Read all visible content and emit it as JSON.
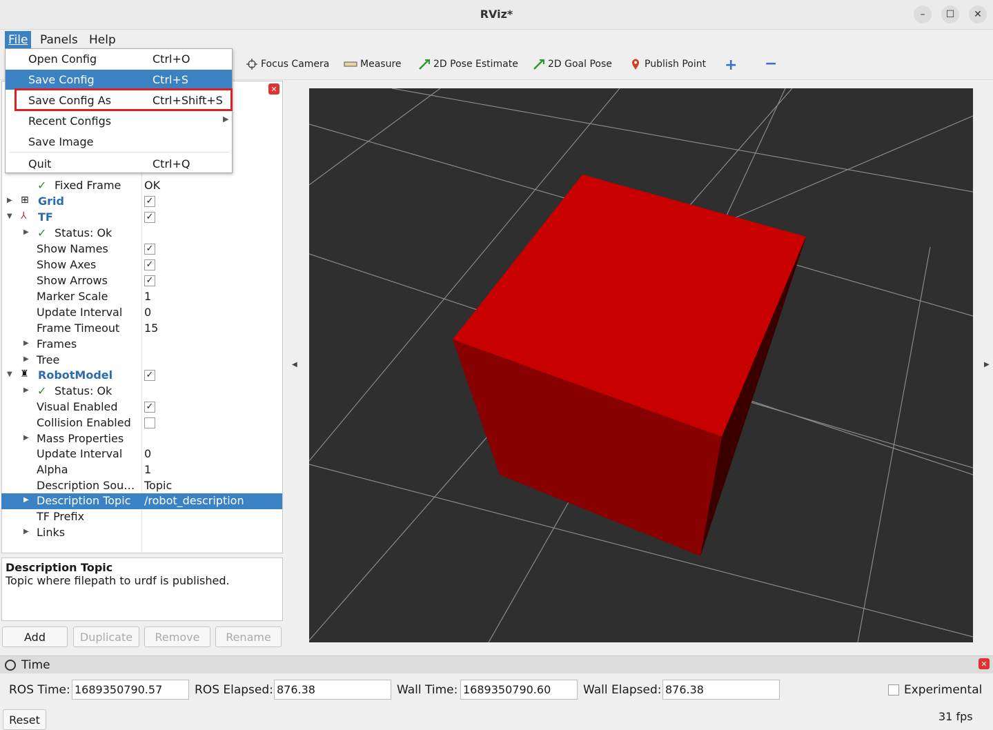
{
  "window": {
    "title": "RViz*",
    "minimize": "–",
    "maximize": "☐",
    "close": "✕"
  },
  "menubar": {
    "file": "File",
    "panels": "Panels",
    "help": "Help"
  },
  "file_menu": {
    "items": [
      {
        "label": "Open Config",
        "shortcut": "Ctrl+O"
      },
      {
        "label": "Save Config",
        "shortcut": "Ctrl+S"
      },
      {
        "label": "Save Config As",
        "shortcut": "Ctrl+Shift+S"
      },
      {
        "label": "Recent Configs",
        "shortcut": ""
      },
      {
        "label": "Save Image",
        "shortcut": ""
      },
      {
        "label": "Quit",
        "shortcut": "Ctrl+Q"
      }
    ],
    "highlighted_item": "Save Config",
    "annotation_color": "#e02020"
  },
  "toolbar": {
    "focus_camera": "Focus Camera",
    "measure": "Measure",
    "pose_estimate": "2D Pose Estimate",
    "goal_pose": "2D Goal Pose",
    "publish_point": "Publish Point",
    "add_tool": "+",
    "remove_tool": "−"
  },
  "displays": {
    "rows": [
      {
        "label": "Fixed Frame",
        "value": "OK"
      },
      {
        "label": "Grid",
        "checked": true
      },
      {
        "label": "TF",
        "checked": true
      },
      {
        "label": "Status: Ok"
      },
      {
        "label": "Show Names",
        "checked": true
      },
      {
        "label": "Show Axes",
        "checked": true
      },
      {
        "label": "Show Arrows",
        "checked": true
      },
      {
        "label": "Marker Scale",
        "value": "1"
      },
      {
        "label": "Update Interval",
        "value": "0"
      },
      {
        "label": "Frame Timeout",
        "value": "15"
      },
      {
        "label": "Frames"
      },
      {
        "label": "Tree"
      },
      {
        "label": "RobotModel",
        "checked": true
      },
      {
        "label": "Status: Ok"
      },
      {
        "label": "Visual Enabled",
        "checked": true
      },
      {
        "label": "Collision Enabled",
        "checked": false
      },
      {
        "label": "Mass Properties"
      },
      {
        "label": "Update Interval",
        "value": "0"
      },
      {
        "label": "Alpha",
        "value": "1"
      },
      {
        "label": "Description Sou…",
        "value": "Topic"
      },
      {
        "label": "Description Topic",
        "value": "/robot_description"
      },
      {
        "label": "TF Prefix",
        "value": ""
      },
      {
        "label": "Links"
      }
    ],
    "selected_row": "Description Topic",
    "check_mark": "✓"
  },
  "description": {
    "heading": "Description Topic",
    "text": "Topic where filepath to urdf is published."
  },
  "panel_buttons": {
    "add": "Add",
    "duplicate": "Duplicate",
    "remove": "Remove",
    "rename": "Rename"
  },
  "time_panel": {
    "title": "Time",
    "ros_time_label": "ROS Time:",
    "ros_time": "1689350790.57",
    "ros_elapsed_label": "ROS Elapsed:",
    "ros_elapsed": "876.38",
    "wall_time_label": "Wall Time:",
    "wall_time": "1689350790.60",
    "wall_elapsed_label": "Wall Elapsed:",
    "wall_elapsed": "876.38",
    "experimental_label": "Experimental",
    "reset": "Reset",
    "fps": "31 fps"
  },
  "colors": {
    "selection": "#3b82c4",
    "cube": "#cc0000",
    "background": "#2f2f2f",
    "grid": "#8a8a8a"
  }
}
